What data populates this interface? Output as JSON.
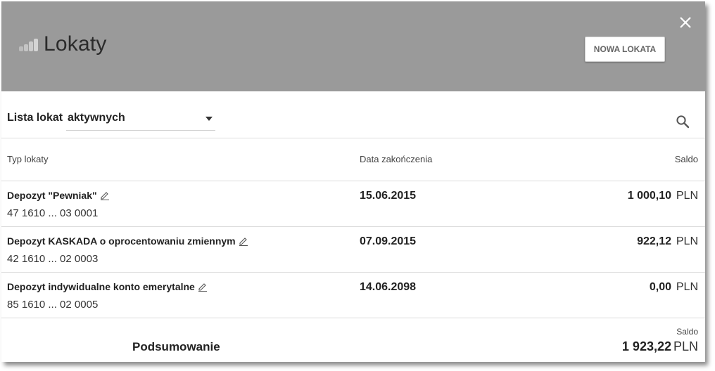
{
  "header": {
    "title": "Lokaty",
    "logo_icon": "coins-icon",
    "new_button_label": "NOWA LOKATA",
    "close_icon": "close-icon",
    "background": "#9a9a9a"
  },
  "filter": {
    "label": "Lista lokat",
    "selected": "aktywnych"
  },
  "columns": {
    "type": "Typ lokaty",
    "end_date": "Data zakończenia",
    "balance": "Saldo"
  },
  "deposits": [
    {
      "name": "Depozyt \"Pewniak\"",
      "account": "47 1610 ... 03 0001",
      "end_date": "15.06.2015",
      "amount": "1 000,10",
      "currency": "PLN"
    },
    {
      "name": "Depozyt KASKADA o oprocentowaniu zmiennym",
      "account": "42 1610 ... 02 0003",
      "end_date": "07.09.2015",
      "amount": "922,12",
      "currency": "PLN"
    },
    {
      "name": "Depozyt indywidualne konto emerytalne",
      "account": "85 1610 ... 02 0005",
      "end_date": "14.06.2098",
      "amount": "0,00",
      "currency": "PLN"
    }
  ],
  "summary": {
    "label": "Podsumowanie",
    "caption": "Saldo",
    "amount": "1 923,22",
    "currency": "PLN"
  }
}
